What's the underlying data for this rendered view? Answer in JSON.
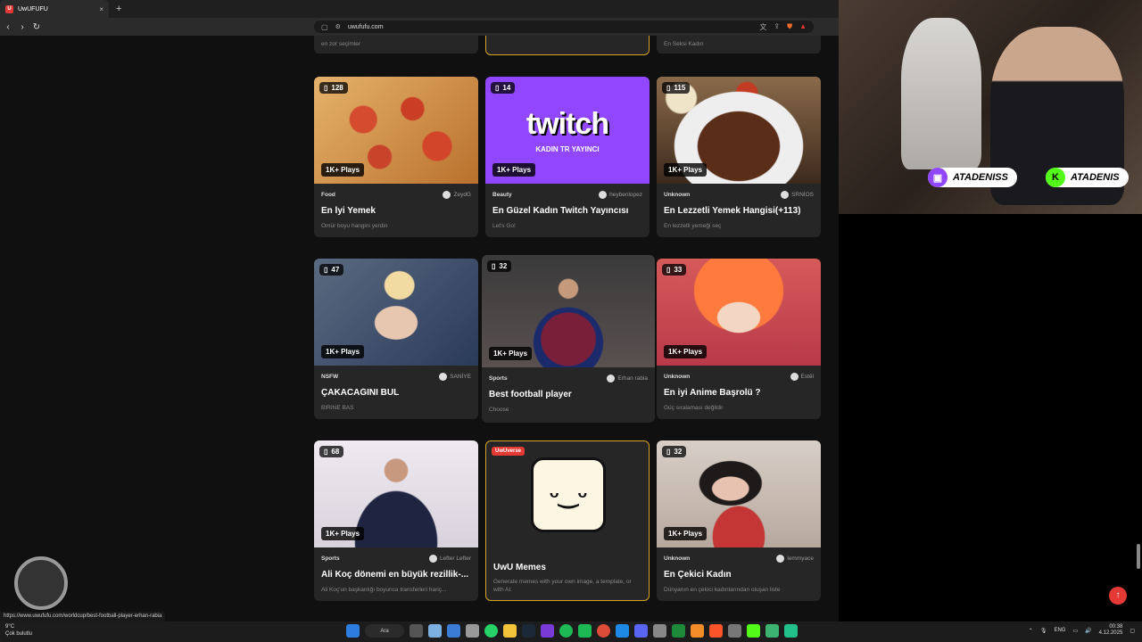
{
  "browser": {
    "tab_title": "UwUFUFU",
    "tab_close": "×",
    "new_tab": "+",
    "url": "uwufufu.com",
    "status_url": "https://www.uwufufu.com/worldcup/best-football-player-erhan-rabia"
  },
  "partial_row": {
    "left_desc": "en zor seçimler",
    "right_desc": "En Seksi Kadın"
  },
  "cards": [
    {
      "count": "128",
      "plays": "1K+ Plays",
      "category": "Food",
      "author": "ZeydG",
      "title": "En İyi Yemek",
      "desc": "Ömür boyu hangini yerdin",
      "color": "#c8843f"
    },
    {
      "count": "14",
      "plays": "1K+ Plays",
      "category": "Beauty",
      "author": "heybenlopez",
      "title": "En Güzel Kadın Twitch Yayıncısı",
      "desc": "Let's Go!",
      "color": "#9146ff",
      "img_text": "twitch",
      "img_sub": "KADIN TR YAYINCI"
    },
    {
      "count": "115",
      "plays": "1K+ Plays",
      "category": "Unknown",
      "author": "SRNİOS",
      "title": "En Lezzetli Yemek Hangisi(+113)",
      "desc": "En lezzetli yemeği seç",
      "color": "#6b3a26"
    },
    {
      "count": "47",
      "plays": "1K+ Plays",
      "category": "NSFW",
      "author": "SANİYE",
      "title": "ÇAKACAĞINI BUL",
      "desc": "BİRİNE BAS",
      "color": "#3b4f7a"
    },
    {
      "count": "32",
      "plays": "1K+ Plays",
      "category": "Sports",
      "author": "Erhan rabia",
      "title": "Best football player",
      "desc": "Choose",
      "color": "#4a2a3c"
    },
    {
      "count": "33",
      "plays": "1K+ Plays",
      "category": "Unknown",
      "author": "Estêl",
      "title": "En iyi Anime Başrolü ?",
      "desc": "Güç sıralaması değildir",
      "color": "#e0604a"
    },
    {
      "count": "68",
      "plays": "1K+ Plays",
      "category": "Sports",
      "author": "Lefter Lefter",
      "title": "Ali Koç dönemi en büyük rezillik-...",
      "desc": "Ali Koç'un başkanlığı boyunca transferleri hariç...",
      "color": "#e6e1e8"
    },
    {
      "badge": "UwUverse",
      "title": "UwU Memes",
      "desc": "Generate memes with your own image, a template, or with AI.",
      "color": "#262626"
    },
    {
      "count": "32",
      "plays": "1K+ Plays",
      "category": "Unknown",
      "author": "lemmyace",
      "title": "En Çekici Kadın",
      "desc": "Dünyanın en çekici kadınlarından oluşan liste",
      "color": "#c7b8b0"
    }
  ],
  "stream": {
    "tag1": "ATADENISS",
    "tag2": "ATADENIS"
  },
  "taskbar": {
    "weather_temp": "9°C",
    "weather_desc": "Çok bulutlu",
    "search": "Ara",
    "lang": "ENG",
    "time": "00:38",
    "date": "4.12.2025"
  }
}
